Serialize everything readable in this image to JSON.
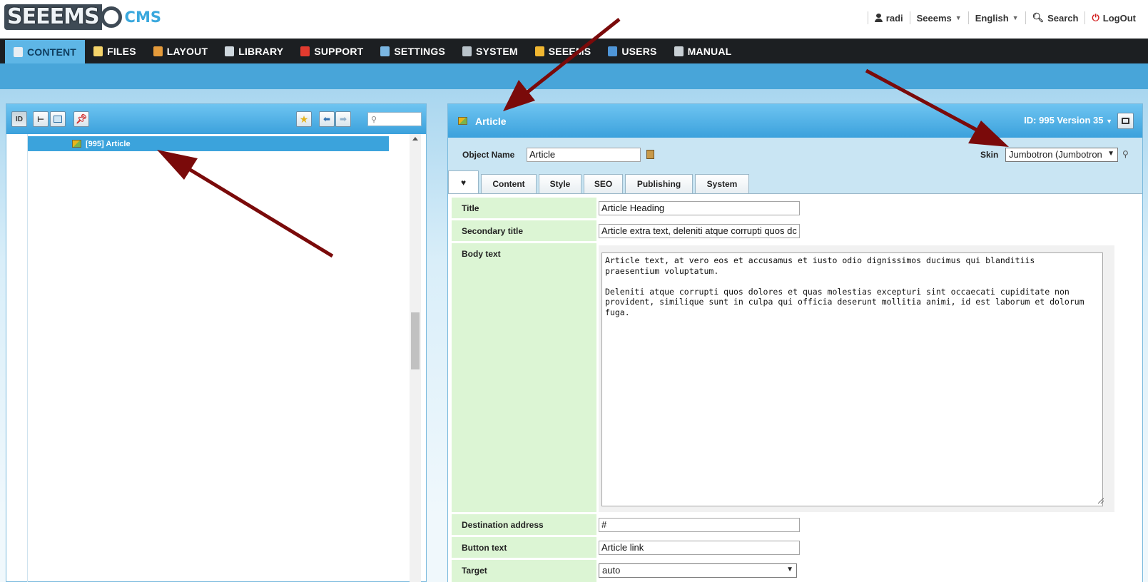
{
  "logo": {
    "part1": "SEEEMS",
    "part2": "CMS"
  },
  "usernav": {
    "user": "radi",
    "site": "Seeems",
    "language": "English",
    "search": "Search",
    "logout": "LogOut"
  },
  "mainnav": [
    {
      "label": "CONTENT",
      "icon": "content-icon",
      "color": "#e8eef3"
    },
    {
      "label": "FILES",
      "icon": "files-icon",
      "color": "#f4d36a"
    },
    {
      "label": "LAYOUT",
      "icon": "layout-icon",
      "color": "#e59b3b"
    },
    {
      "label": "LIBRARY",
      "icon": "library-icon",
      "color": "#cfd8de"
    },
    {
      "label": "SUPPORT",
      "icon": "support-icon",
      "color": "#e23b2f"
    },
    {
      "label": "SETTINGS",
      "icon": "settings-icon",
      "color": "#7ab6e2"
    },
    {
      "label": "SYSTEM",
      "icon": "system-icon",
      "color": "#b9c3ca"
    },
    {
      "label": "SEEEMS",
      "icon": "star-icon",
      "color": "#f1b731"
    },
    {
      "label": "USERS",
      "icon": "users-icon",
      "color": "#4f96d8"
    },
    {
      "label": "MANUAL",
      "icon": "manual-icon",
      "color": "#c9d0d5"
    }
  ],
  "tree": {
    "toolbar": {
      "id_label": "ID"
    },
    "selected_item": "[995] Article"
  },
  "editor": {
    "title": "Article",
    "version": "ID: 995 Version 35",
    "object_name_label": "Object Name",
    "object_name_value": "Article",
    "skin_label": "Skin",
    "skin_value": "Jumbotron (Jumbotron",
    "tabs": [
      "♥",
      "Content",
      "Style",
      "SEO",
      "Publishing",
      "System"
    ],
    "fields": {
      "title_label": "Title",
      "title_value": "Article Heading",
      "secondary_label": "Secondary title",
      "secondary_value": "Article extra text, deleniti atque corrupti quos dc",
      "body_label": "Body text",
      "body_value": "Article text, at vero eos et accusamus et iusto odio dignissimos ducimus qui blanditiis\npraesentium voluptatum.\n\nDeleniti atque corrupti quos dolores et quas molestias excepturi sint occaecati cupiditate non\nprovident, similique sunt in culpa qui officia deserunt mollitia animi, id est laborum et dolorum\nfuga.",
      "dest_label": "Destination address",
      "dest_value": "#",
      "button_label": "Button text",
      "button_value": "Article link",
      "target_label": "Target",
      "target_value": "auto"
    }
  },
  "colors": {
    "accent": "#3ba1dc",
    "nav_bg": "#1c1f22",
    "label_bg": "#dcf5d4",
    "arrow": "#7a0a0a"
  }
}
